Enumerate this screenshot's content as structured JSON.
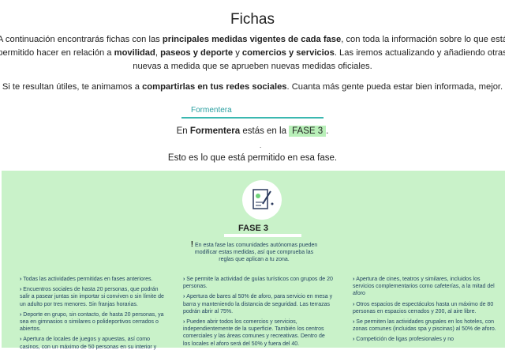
{
  "header": {
    "title": "Fichas"
  },
  "intro": {
    "p1_a": "A continuación encontrarás fichas con las ",
    "p1_b": "principales medidas vigentes de cada fase",
    "p1_c": ", con toda la información sobre lo que está permitido hacer en relación a ",
    "p1_d": "movilidad",
    "p1_e": ", ",
    "p1_f": "paseos y deporte",
    "p1_g": " y ",
    "p1_h": "comercios y servicios",
    "p1_i": ". Las iremos actualizando y añadiendo otras nuevas a medida que se aprueben nuevas medidas oficiales.",
    "p2_a": "Si te resultan útiles, te animamos a ",
    "p2_b": "compartirlas en tus redes sociales",
    "p2_c": ". Cuanta más gente pueda estar bien informada, mejor."
  },
  "selector": {
    "value": "Formentera"
  },
  "status": {
    "pre": "En ",
    "region": "Formentera",
    "mid": " estás en la ",
    "phase": "FASE 3",
    "post": ".",
    "dot": ".",
    "allowed": "Esto es lo que está permitido en esa fase."
  },
  "card": {
    "icon": "notepad-pen-icon",
    "title": "FASE 3",
    "note_mark": "!",
    "note": "En esta fase las comunidades autónomas pueden modificar estas medidas, así que comprueba las reglas que aplican a tu zona.",
    "columns": [
      [
        "Todas las actividades permitidas en fases anteriores.",
        "Encuentros sociales de hasta 20 personas, que podrán salir a pasear juntas sin importar si conviven o sin límite de un adulto por tres menores. Sin franjas horarias.",
        "Deporte en grupo, sin contacto, de hasta 20 personas, ya sea en gimnasios o similares o polideportivos cerrados o abiertos.",
        "Apertura de locales de juegos y apuestas, así como casinos, con un máximo de 50 personas en su interior y"
      ],
      [
        "Se permite la actividad de guías turísticos con grupos de 20 personas.",
        "Apertura de bares al 50% de aforo, para servicio en mesa y barra y manteniendo la distancia de seguridad. Las terrazas podrán abrir al 75%.",
        "Pueden abrir todos los comercios y servicios, independientemente de la superficie. También los centros comerciales y las áreas comunes y recreativas. Dentro de los locales el aforo será del 50% y fuera del 40."
      ],
      [
        "Apertura de cines, teatros y similares, incluidos los servicios complementarios como cafeterías, a la mitad del aforo",
        "Otros espacios de espectáculos hasta un máximo de 80 personas en espacios cerrados y 200, al aire libre.",
        "Se permiten las actividades grupales en los hoteles, con zonas comunes (incluidas spa y piscinas) al 50% de aforo.",
        "Competición de ligas profesionales y no"
      ]
    ]
  }
}
